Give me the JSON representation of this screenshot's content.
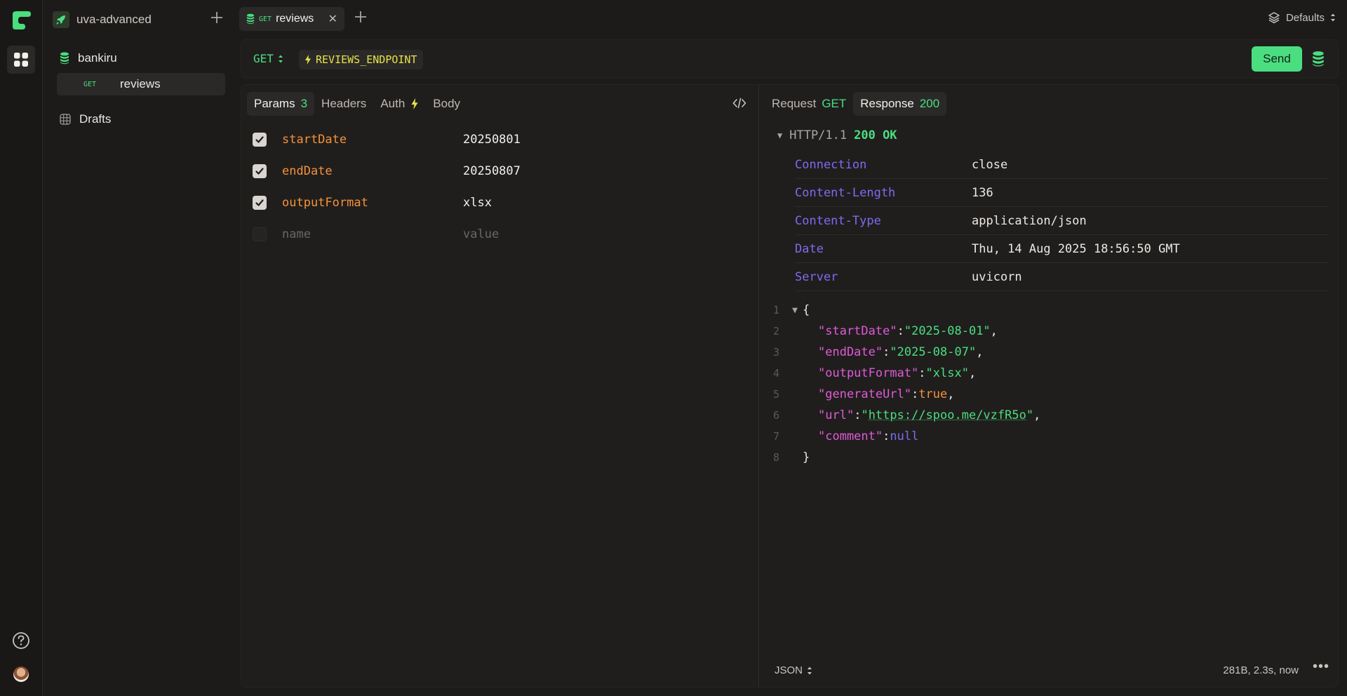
{
  "workspace": {
    "name": "uva-advanced"
  },
  "sidebar": {
    "folder": {
      "label": "bankiru"
    },
    "request": {
      "method": "GET",
      "label": "reviews"
    },
    "drafts": {
      "label": "Drafts"
    }
  },
  "tabs": [
    {
      "method": "GET",
      "label": "reviews"
    }
  ],
  "environment": {
    "label": "Defaults"
  },
  "request": {
    "method": "GET",
    "endpoint": "REVIEWS_ENDPOINT",
    "send_label": "Send",
    "tabs": {
      "params": "Params",
      "params_count": "3",
      "headers": "Headers",
      "auth": "Auth",
      "body": "Body"
    },
    "params": [
      {
        "enabled": true,
        "name": "startDate",
        "value": "20250801"
      },
      {
        "enabled": true,
        "name": "endDate",
        "value": "20250807"
      },
      {
        "enabled": true,
        "name": "outputFormat",
        "value": "xlsx"
      }
    ],
    "new_param": {
      "name_placeholder": "name",
      "value_placeholder": "value"
    }
  },
  "response": {
    "tabs": {
      "request": "Request",
      "request_method": "GET",
      "response": "Response",
      "response_status": "200"
    },
    "protocol": "HTTP/1.1",
    "status": "200 OK",
    "headers": [
      {
        "key": "Connection",
        "value": "close"
      },
      {
        "key": "Content-Length",
        "value": "136"
      },
      {
        "key": "Content-Type",
        "value": "application/json"
      },
      {
        "key": "Date",
        "value": "Thu, 14 Aug 2025 18:56:50 GMT"
      },
      {
        "key": "Server",
        "value": "uvicorn"
      }
    ],
    "line_numbers": [
      "1",
      "2",
      "3",
      "4",
      "5",
      "6",
      "7",
      "8"
    ],
    "body": {
      "open": "{",
      "close": "}",
      "startDate": {
        "key": "\"startDate\"",
        "value": "\"2025-08-01\""
      },
      "endDate": {
        "key": "\"endDate\"",
        "value": "\"2025-08-07\""
      },
      "outputFormat": {
        "key": "\"outputFormat\"",
        "value": "\"xlsx\""
      },
      "generateUrl": {
        "key": "\"generateUrl\"",
        "value": "true"
      },
      "url": {
        "key": "\"url\"",
        "value_url": "https://spoo.me/vzfR5o"
      },
      "comment": {
        "key": "\"comment\"",
        "value": "null"
      }
    },
    "format": "JSON",
    "meta": "281B, 2.3s, now"
  },
  "colors": {
    "accent_green": "#4ade80",
    "param_name": "#f5923a",
    "header_key": "#7c6cf0",
    "json_key": "#e05ad8",
    "endpoint_var": "#e6e24a"
  }
}
